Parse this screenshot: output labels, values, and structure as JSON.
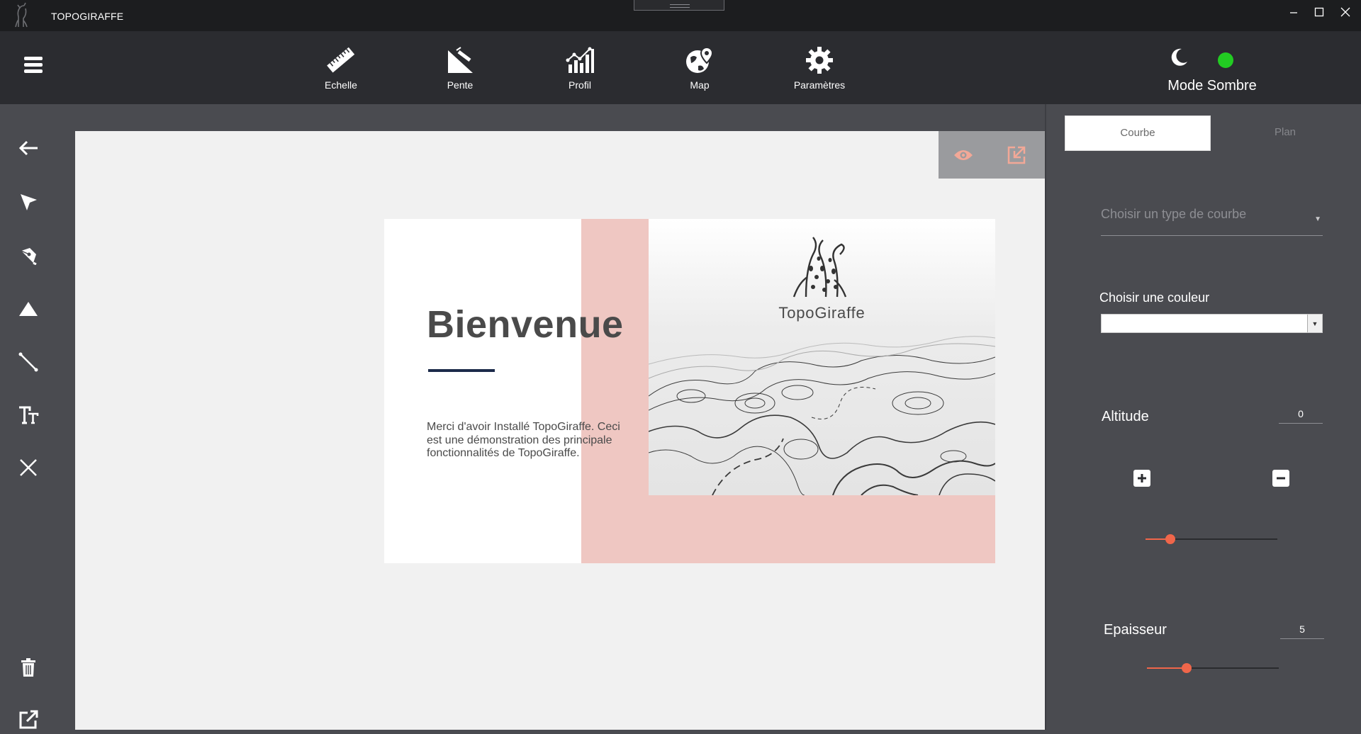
{
  "window": {
    "title": "TOPOGIRAFFE"
  },
  "toolbar": {
    "tools": [
      {
        "label": "Echelle",
        "icon": "ruler-icon"
      },
      {
        "label": "Pente",
        "icon": "slope-icon"
      },
      {
        "label": "Profil",
        "icon": "profile-chart-icon"
      },
      {
        "label": "Map",
        "icon": "globe-pin-icon"
      },
      {
        "label": "Paramètres",
        "icon": "gear-icon"
      }
    ],
    "mode_label": "Mode Sombre",
    "status_color": "#22cc22"
  },
  "left_rail": [
    "back-arrow-icon",
    "pointer-icon",
    "pen-icon",
    "triangle-icon",
    "line-icon",
    "text-size-icon",
    "close-icon",
    "trash-icon",
    "export-icon"
  ],
  "welcome": {
    "title": "Bienvenue",
    "text": "Merci d'avoir Installé TopoGiraffe. Ceci est une démonstration des principale fonctionnalités de TopoGiraffe.",
    "brand": "TopoGiraffe",
    "accent_color": "#efc7c2"
  },
  "panel": {
    "tabs": [
      {
        "label": "Courbe",
        "active": true
      },
      {
        "label": "Plan",
        "active": false
      }
    ],
    "courbe_type_placeholder": "Choisir un type de courbe",
    "color_label": "Choisir une couleur",
    "altitude": {
      "label": "Altitude",
      "value": "0",
      "slider_fraction": 0.19
    },
    "epaisseur": {
      "label": "Epaisseur",
      "value": "5",
      "slider_fraction": 0.3
    },
    "accent_color": "#f0664a"
  }
}
